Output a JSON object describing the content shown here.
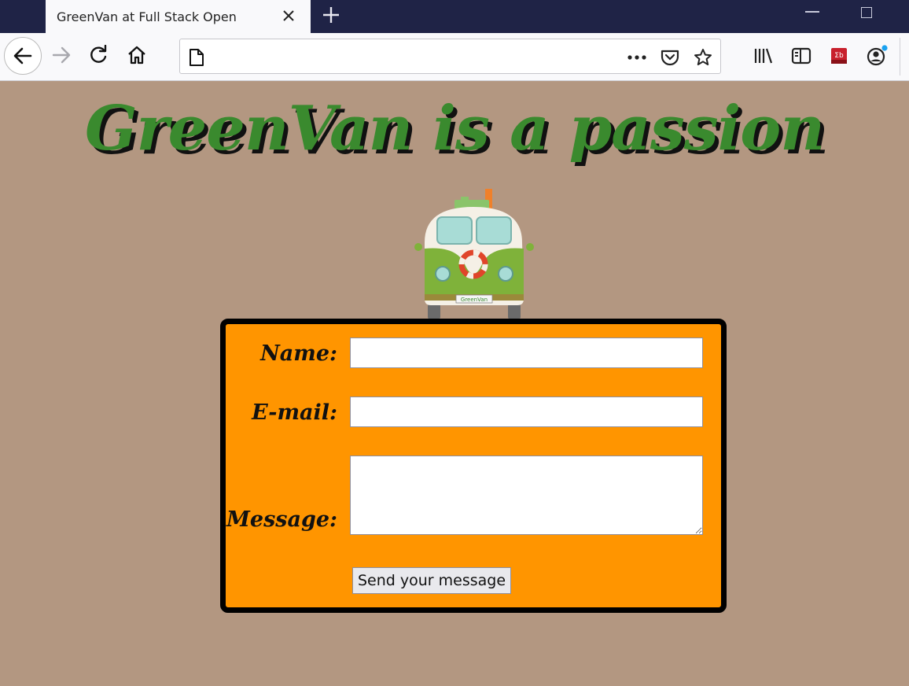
{
  "browser": {
    "tab_title": "GreenVan at Full Stack Open",
    "url": ""
  },
  "page": {
    "headline": "GreenVan is a passion",
    "van_plate": "GreenVan",
    "form": {
      "name_label": "Name:",
      "email_label": "E-mail:",
      "message_label": "Message:",
      "name_value": "",
      "email_value": "",
      "message_value": "",
      "submit_label": "Send your message"
    }
  },
  "colors": {
    "page_background": "#b39781",
    "headline": "#3a8a2e",
    "form_background": "#ff9500",
    "titlebar": "#1f2346"
  }
}
